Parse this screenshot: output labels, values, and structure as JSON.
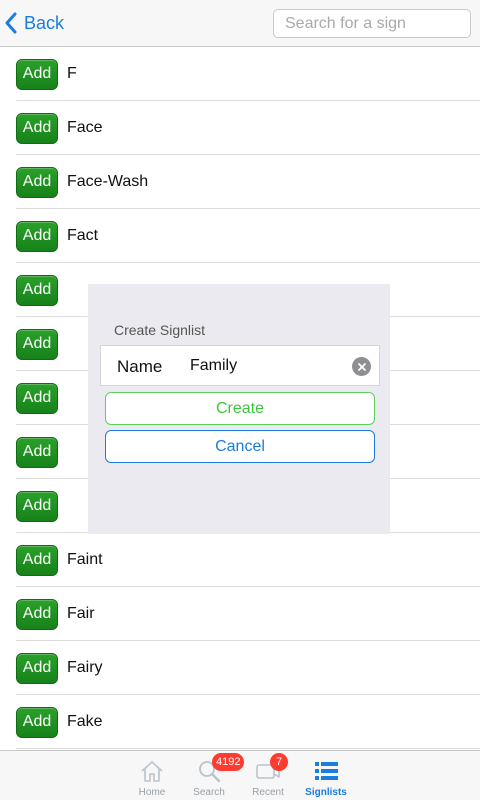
{
  "header": {
    "back_label": "Back",
    "search_placeholder": "Search for a sign"
  },
  "list": {
    "add_label": "Add",
    "items": [
      "F",
      "Face",
      "Face-Wash",
      "Fact",
      "",
      "",
      "",
      "",
      "",
      "Faint",
      "Fair",
      "Fairy",
      "Fake"
    ]
  },
  "dialog": {
    "title": "Create Signlist",
    "name_label": "Name",
    "name_value": "Family",
    "create_label": "Create",
    "cancel_label": "Cancel"
  },
  "tabbar": {
    "tabs": [
      {
        "label": "Home",
        "icon": "home-icon",
        "badge": ""
      },
      {
        "label": "Search",
        "icon": "search-icon",
        "badge": "4192"
      },
      {
        "label": "Recent",
        "icon": "recent-icon",
        "badge": "7"
      },
      {
        "label": "Signlists",
        "icon": "list-icon",
        "badge": ""
      }
    ],
    "active": "Signlists"
  },
  "colors": {
    "accent": "#1a7de0",
    "add_green": "#1f8f22",
    "create_green": "#3cc43c",
    "badge_red": "#ff3b30"
  }
}
